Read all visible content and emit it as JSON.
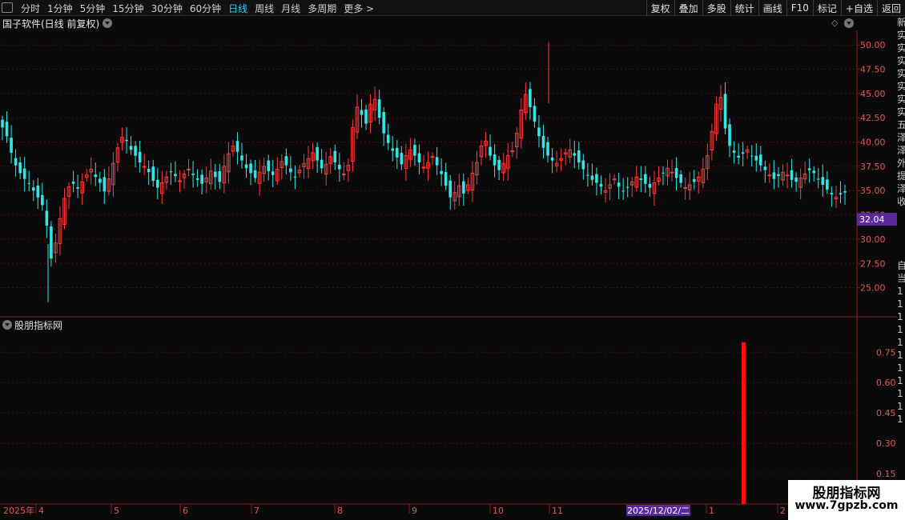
{
  "toolbar": {
    "periods": [
      "分时",
      "1分钟",
      "5分钟",
      "15分钟",
      "30分钟",
      "60分钟",
      "日线",
      "周线",
      "月线",
      "多周期",
      "更多 >"
    ],
    "active_period": "日线",
    "tools": [
      "复权",
      "叠加",
      "多股",
      "统计",
      "画线",
      "F10",
      "标记",
      "+自选",
      "返回"
    ]
  },
  "chart_title": "国子软件(日线 前复权)",
  "price_axis": {
    "ticks": [
      "50.00",
      "47.50",
      "45.00",
      "42.50",
      "40.00",
      "37.50",
      "35.00",
      "32.50",
      "30.00",
      "27.50",
      "25.00"
    ],
    "current_price": "32.04"
  },
  "indicator": {
    "title": "股朋指标网",
    "ticks": [
      "0.75",
      "0.60",
      "0.45",
      "0.30",
      "0.15"
    ]
  },
  "time_axis": {
    "labels": [
      "2025年",
      "4",
      "5",
      "6",
      "7",
      "8",
      "9",
      "10",
      "11",
      "2025/12/02/二",
      "1",
      "2"
    ]
  },
  "side_strip_chars": [
    "新",
    "实",
    "实",
    "实",
    "实",
    "实",
    "实",
    "实",
    "五",
    "泽",
    "泽",
    "外",
    "提",
    "泽",
    "收",
    "",
    "",
    "",
    "",
    "自",
    "当",
    "1",
    "1",
    "1",
    "1",
    "1",
    "1",
    "1",
    "1",
    "1",
    "1",
    "1"
  ],
  "watermark": {
    "line1": "股朋指标网",
    "line2": "www.7gpzb.com"
  },
  "colors": {
    "up": "#ff3a3a",
    "down": "#33e6e6",
    "grid": "#5a0c0c",
    "axis": "#8a1a1a",
    "signal": "#ff1010",
    "active_tab": "#38c8ff",
    "price_tag_bg": "#5a2a9a"
  },
  "chart_data": {
    "type": "candlestick",
    "y_range": [
      22.0,
      51.5
    ],
    "indicator_y_range": [
      0,
      0.85
    ],
    "signal_bar": {
      "date": "2025/12/02",
      "value": 0.8
    },
    "candles": []
  }
}
